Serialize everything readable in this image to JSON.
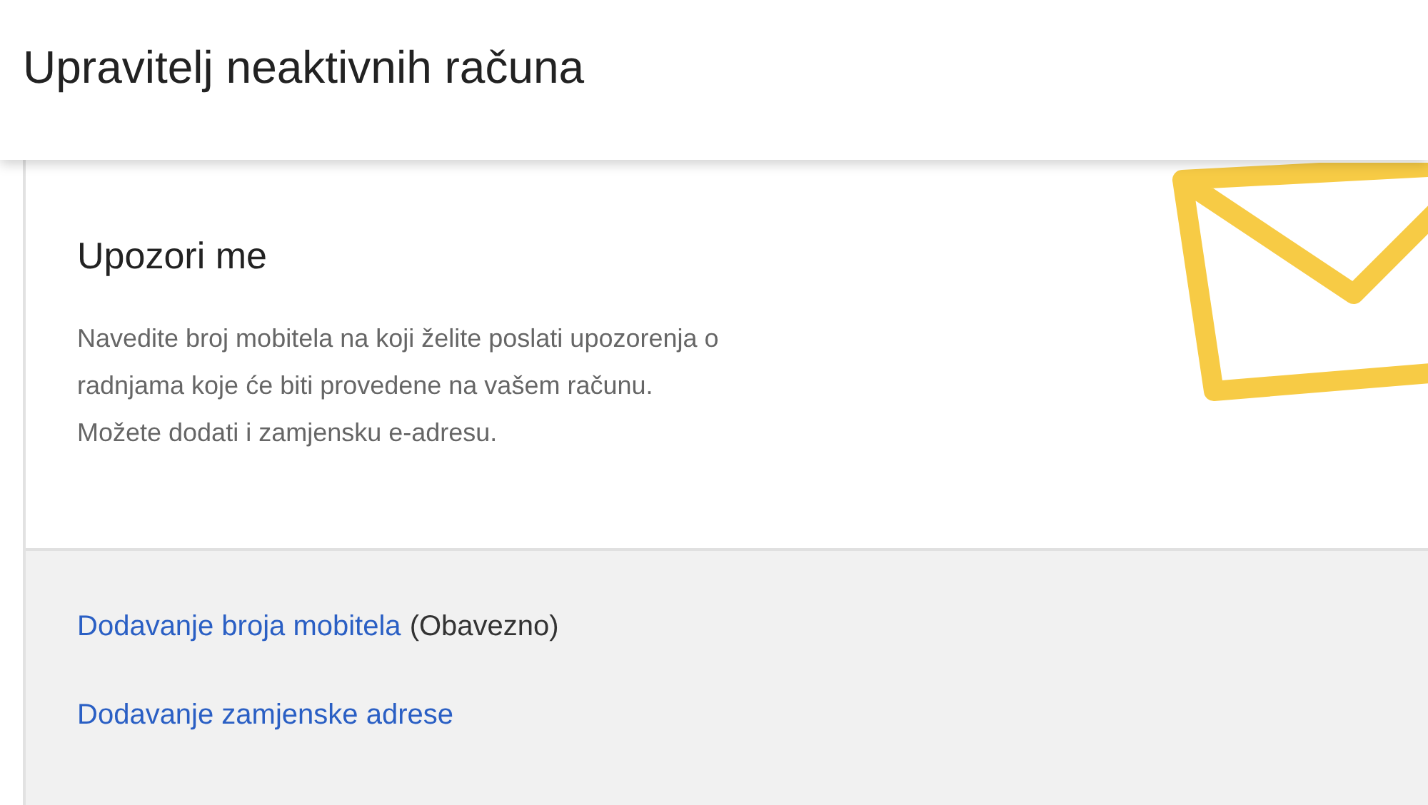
{
  "header": {
    "title": "Upravitelj neaktivnih računa"
  },
  "card": {
    "heading": "Upozori me",
    "description_lines": [
      "Navedite broj mobitela na koji želite poslati upozorenja o",
      "radnjama koje će biti provedene na vašem računu.",
      "Možete dodati i zamjensku e-adresu."
    ],
    "actions": [
      {
        "label": "Dodavanje broja mobitela",
        "note": "(Obavezno)"
      },
      {
        "label": "Dodavanje zamjenske adrese"
      }
    ]
  }
}
